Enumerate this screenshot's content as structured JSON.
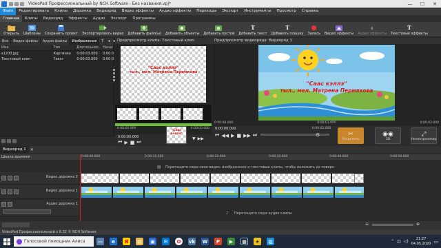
{
  "window": {
    "title": "VideoPad Профессиональный by NCH Software - Без названия.vpj*",
    "minimize": "—",
    "maximize": "☐",
    "close": "✕"
  },
  "menu": [
    "Файл",
    "Редактировать",
    "Клипы",
    "Дорожка",
    "Видеоряд",
    "Видео эффекты",
    "Аудио эффекты",
    "Переходы",
    "Экспорт",
    "Инструменты",
    "Просмотр",
    "Справка"
  ],
  "ribbon_tabs": [
    "Главная",
    "Клипы",
    "Видеоряд",
    "Эффекты",
    "Аудио",
    "Экспорт",
    "Программы"
  ],
  "toolbar": [
    {
      "icon": "open-icon",
      "label": "Открыть"
    },
    {
      "icon": "templates-icon",
      "label": "Шаблоны"
    },
    {
      "icon": "save-icon",
      "label": "Сохранить проект"
    },
    {
      "icon": "export-icon",
      "label": "Экспортировать видео"
    },
    {
      "icon": "add-files-icon",
      "label": "Добавить файл(ы)"
    },
    {
      "icon": "add-objects-icon",
      "label": "Добавить объекты"
    },
    {
      "icon": "add-blank-icon",
      "label": "Добавить пустой"
    },
    {
      "icon": "add-text-icon",
      "label": "Добавить текст"
    },
    {
      "icon": "add-plate-icon",
      "label": "Добавить плашку"
    },
    {
      "icon": "record-icon",
      "label": "Запись"
    },
    {
      "icon": "video-effects-icon",
      "label": "Видео эффекты"
    },
    {
      "icon": "audio-effects-icon",
      "label": "Аудио эффекты"
    },
    {
      "icon": "text-effects-icon",
      "label": "Текстовые эффекты"
    }
  ],
  "bin": {
    "tabs": [
      "Все",
      "Видео файлы",
      "Аудио файлы",
      "Изображения",
      "Т"
    ],
    "columns": [
      "Имя",
      "Тип",
      "Длительнос...",
      "Начал"
    ],
    "rows": [
      {
        "name": "s1200.jpg",
        "type": "Картинка",
        "duration": "0:00:03.000",
        "start": "0:00:0"
      },
      {
        "name": "Текстовый клип",
        "type": "Текст",
        "duration": "0:00:03.000",
        "start": "0:00:0"
      }
    ]
  },
  "clip_preview": {
    "header": "Предпросмотр клипа: Текстовый клип",
    "text_line1": "\"Саас кэллэ\"",
    "text_line2": "тыл., мел. Матрена Пермякова",
    "tc_left": "0:00:00.000",
    "tc_right": "0:00:02.000",
    "current": "0:00:00.000",
    "thumb_line1": "\"Саас",
    "thumb_line2": "кэллэ\""
  },
  "seq_preview": {
    "header": "Предпросмотр видеоряда: Видеоряд 1",
    "text_line1": "\"Саас кэллэ\"",
    "text_line2": "тыл., мел. Матрена Пермякова",
    "tc_left": "0:00:00.000",
    "tc_mid": "0:00:01.000",
    "tc_right": "0:00:02.000",
    "current": "0:00:00.000",
    "tc_extra": "0:00:02.000",
    "split_label": "Разделить",
    "threed_label": "3D",
    "unlink_label": "Несинхронизир"
  },
  "timeline": {
    "tab": "Видеоряд 1",
    "scale_label": "Шкала времени",
    "ticks": [
      "0:00:00.000",
      "0:00:10.000",
      "0:00:20.000",
      "0:00:30.000",
      "0:00:40.000",
      "0:00:50.000"
    ],
    "video_hint": "Перетащите сюда свои видео, изображения и текстовые клипы, чтобы наложить их поверх",
    "video_track2": "Видео дорожка 2",
    "video_track1": "Видео дорожка 1",
    "audio_track1": "Аудио дорожка 1",
    "audio_hint": "Перетащите сюда аудио клипы"
  },
  "status": "VideoPad Профессиональный v 6.32 © NCH Software",
  "taskbar": {
    "search_placeholder": "Голосовой помощник Алиса",
    "time": "21:27",
    "date": "04.05.2020"
  },
  "colors": {
    "accent": "#1f8ad8",
    "clip_text": "#d41c1c",
    "playhead": "#e02020"
  }
}
